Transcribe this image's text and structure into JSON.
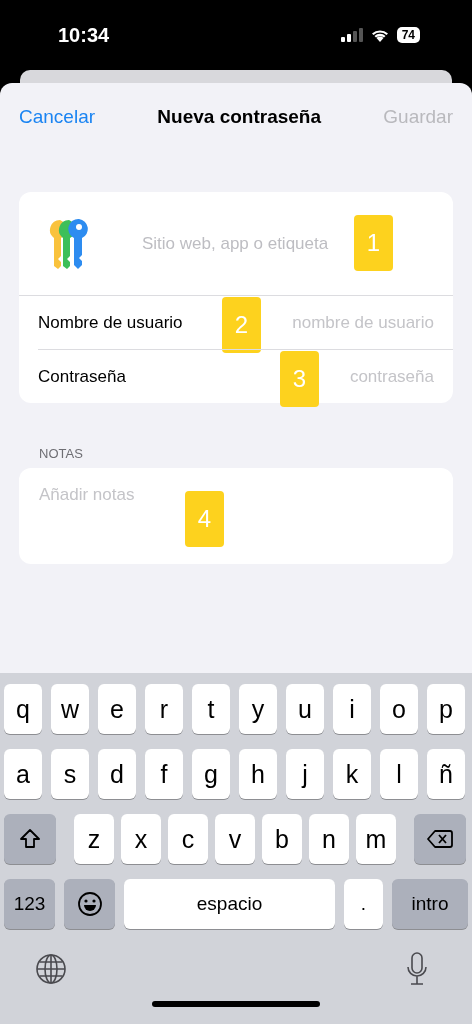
{
  "status_bar": {
    "time": "10:34",
    "battery": "74"
  },
  "nav": {
    "cancel": "Cancelar",
    "title": "Nueva contraseña",
    "save": "Guardar",
    "save_disabled": true
  },
  "entry": {
    "placeholder": "Sitio web, app o etiqueta",
    "marker": "1"
  },
  "fields": [
    {
      "label": "Nombre de usuario",
      "placeholder": "nombre de usuario",
      "marker": "2"
    },
    {
      "label": "Contraseña",
      "placeholder": "contraseña",
      "marker": "3"
    }
  ],
  "notes": {
    "header": "NOTAS",
    "placeholder": "Añadir notas",
    "marker": "4"
  },
  "keyboard": {
    "letter_rows": [
      [
        {
          "kind": "letter",
          "label": "q"
        },
        {
          "kind": "letter",
          "label": "w"
        },
        {
          "kind": "letter",
          "label": "e"
        },
        {
          "kind": "letter",
          "label": "r"
        },
        {
          "kind": "letter",
          "label": "t"
        },
        {
          "kind": "letter",
          "label": "y"
        },
        {
          "kind": "letter",
          "label": "u"
        },
        {
          "kind": "letter",
          "label": "i"
        },
        {
          "kind": "letter",
          "label": "o"
        },
        {
          "kind": "letter",
          "label": "p"
        }
      ],
      [
        {
          "kind": "letter",
          "label": "a"
        },
        {
          "kind": "letter",
          "label": "s"
        },
        {
          "kind": "letter",
          "label": "d"
        },
        {
          "kind": "letter",
          "label": "f"
        },
        {
          "kind": "letter",
          "label": "g"
        },
        {
          "kind": "letter",
          "label": "h"
        },
        {
          "kind": "letter",
          "label": "j"
        },
        {
          "kind": "letter",
          "label": "k"
        },
        {
          "kind": "letter",
          "label": "l"
        },
        {
          "kind": "letter",
          "label": "ñ"
        }
      ],
      [
        {
          "kind": "shift"
        },
        {
          "kind": "letter",
          "label": "z"
        },
        {
          "kind": "letter",
          "label": "x"
        },
        {
          "kind": "letter",
          "label": "c"
        },
        {
          "kind": "letter",
          "label": "v"
        },
        {
          "kind": "letter",
          "label": "b"
        },
        {
          "kind": "letter",
          "label": "n"
        },
        {
          "kind": "letter",
          "label": "m"
        },
        {
          "kind": "delete"
        }
      ]
    ],
    "bottom_row": [
      {
        "kind": "numbers",
        "label": "123"
      },
      {
        "kind": "emoji"
      },
      {
        "kind": "space",
        "label": "espacio"
      },
      {
        "kind": "period",
        "label": "."
      },
      {
        "kind": "return",
        "label": "intro"
      }
    ]
  }
}
